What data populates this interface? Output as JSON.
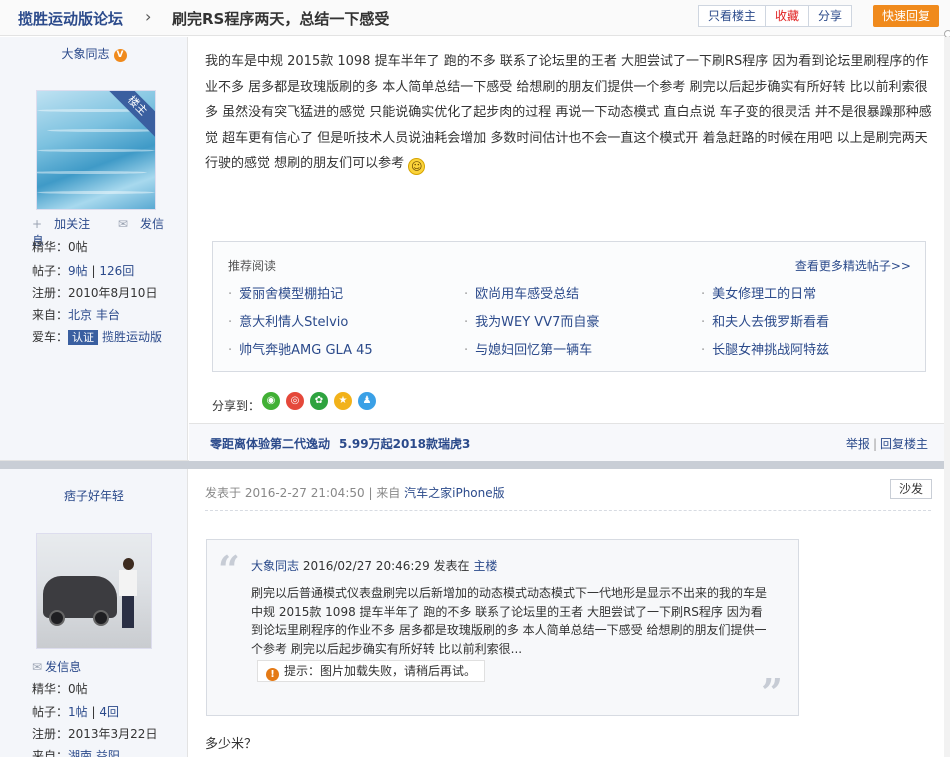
{
  "header": {
    "forum_name": "揽胜运动版论坛",
    "chevron": "›",
    "thread_title": "刷完RS程序两天，总结一下感受",
    "btn_only_op": "只看楼主",
    "btn_favorite": "收藏",
    "btn_share": "分享",
    "btn_quick_reply": "快速回复"
  },
  "post1": {
    "author": {
      "name": "大象同志",
      "badge": "V",
      "op_tag": "楼主",
      "follow": "加关注",
      "message": "发信息",
      "essence": "精华：0帖",
      "posts_label": "帖子：",
      "posts_a": "9帖",
      "posts_sep": "|",
      "posts_b": "126回",
      "register": "注册：2010年8月10日",
      "from_label": "来自：",
      "from_value": "北京 丰台",
      "car_label": "爱车：",
      "car_tag": "认证",
      "car_value": "揽胜运动版"
    },
    "text": "我的车是中规 2015款 1098   提车半年了  跑的不多 联系了论坛里的王者   大胆尝试了一下刷RS程序   因为看到论坛里刷程序的作业不多   居多都是玫瑰版刷的多   本人简单总结一下感受   给想刷的朋友们提供一个参考    刷完以后起步确实有所好转   比以前利索很多    虽然没有突飞猛进的感觉  只能说确实优化了起步肉的过程     再说一下动态模式   直白点说   车子变的很灵活   并不是很暴躁那种感觉    超车更有信心了    但是听技术人员说油耗会增加  多数时间估计也不会一直这个模式开    着急赶路的时候在用吧     以上是刷完两天行驶的感觉   想刷的朋友们可以参考",
    "smiley": "☺",
    "recommend": {
      "title": "推荐阅读",
      "more": "查看更多精选帖子>>",
      "items": [
        "爱丽舍模型棚拍记",
        "欧尚用车感受总结",
        "美女修理工的日常",
        "意大利情人Stelvio",
        "我为WEY VV7而自豪",
        "和夫人去俄罗斯看看",
        "帅气奔驰AMG GLA 45",
        "与媳妇回忆第一辆车",
        "长腿女神挑战阿特兹"
      ]
    },
    "share_label": "分享到：",
    "share_icons": [
      "wechat-icon",
      "weibo-icon",
      "moments-icon",
      "qzone-icon",
      "qq-icon"
    ],
    "ad1": "零距离体验第二代逸动",
    "ad2": "5.99万起2018款瑞虎3",
    "report": "举报",
    "report_sep": "|",
    "reply_op": "回复楼主"
  },
  "post2": {
    "author": {
      "name": "痞子好年轻",
      "message": "发信息",
      "essence": "精华：0帖",
      "posts_label": "帖子：",
      "posts_a": "1帖",
      "posts_sep": "|",
      "posts_b": "4回",
      "register": "注册：2013年3月22日",
      "from_label": "来自：",
      "from_value": "湖南 益阳"
    },
    "meta_prefix": "发表于 2016-2-27 21:04:50 | 来自 ",
    "meta_source": "汽车之家iPhone版",
    "sofa": "沙发",
    "quote": {
      "author": "大象同志",
      "time": " 2016/02/27 20:46:29 发表在 ",
      "floor": "主楼",
      "text": "刷完以后普通模式仪表盘刷完以后新增加的动态模式动态模式下一代地形是显示不出来的我的车是中规 2015款 1098    提车半年了  跑的不多 联系了论坛里的王者    大胆尝试了一下刷RS程序   因为看到论坛里刷程序的作业不多   居多都是玫瑰版刷的多    本人简单总结一下感受    给想刷的朋友们提供一个参考    刷完以后起步确实有所好转  比以前利索很...",
      "img_fail": "提示：图片加载失败，请稍后再试。"
    },
    "reply": "多少米？"
  },
  "colors": {
    "link": "#2b4a8b",
    "accent_orange": "#f08a1c",
    "favorite_red": "#e02020",
    "sidebar_bg": "#f4f6fa",
    "separator": "#c9ced6"
  }
}
